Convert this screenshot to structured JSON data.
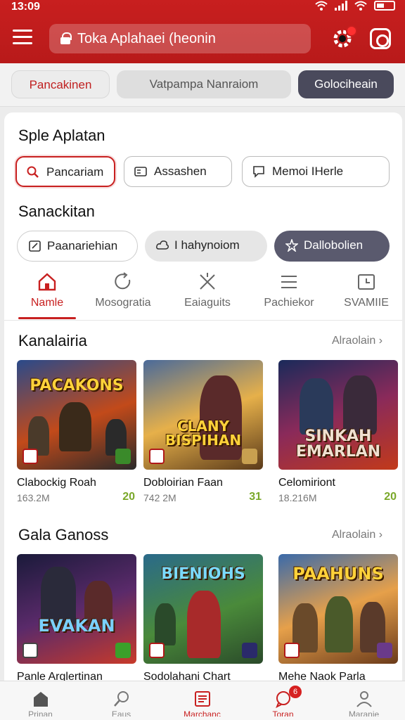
{
  "status_bar": {
    "time": "13:09"
  },
  "header": {
    "search_text": "Toka Aplahaei (heonin",
    "accent": "#c81f1f"
  },
  "top_tabs": [
    "Pancakinen",
    "Vatpampa Nanraiom",
    "Golociheain"
  ],
  "section1": {
    "title": "Sple Aplatan",
    "chips": [
      "Pancariam",
      "Assashen",
      "Memoi IHerle"
    ]
  },
  "section2": {
    "title": "Sanackitan",
    "chips": [
      "Paanariehian",
      "I hahynoiom",
      "Dallobolien"
    ]
  },
  "categories": [
    {
      "label": "Namle",
      "icon": "home-icon"
    },
    {
      "label": "Mosogratia",
      "icon": "refresh-icon"
    },
    {
      "label": "Eaiaguits",
      "icon": "cross-tools-icon"
    },
    {
      "label": "Pachiekor",
      "icon": "list-icon"
    },
    {
      "label": "SVAMIIE",
      "icon": "calendar-icon"
    }
  ],
  "rail1": {
    "title": "Kanalairia",
    "more": "Alraolain ›",
    "games": [
      {
        "thumb_title": "PACAKONS",
        "name": "Clabockig Roah",
        "size": "163.2M",
        "rating": "20"
      },
      {
        "thumb_title": "CLANY BISPIHAN",
        "name": "Dobloirian Faan",
        "size": "742 2M",
        "rating": "31"
      },
      {
        "thumb_title": "SINKAH EMARLAN",
        "name": "Celomiriont",
        "size": "18.216M",
        "rating": "20"
      }
    ]
  },
  "rail2": {
    "title": "Gala Ganoss",
    "more": "Alraolain ›",
    "games": [
      {
        "thumb_title": "EVAKAN",
        "name": "Panle Arglertinan"
      },
      {
        "thumb_title": "BIENIOHS",
        "name": "Sodolahani Chart"
      },
      {
        "thumb_title": "PAAHUNS",
        "name": "Mehe Naok Parla"
      }
    ]
  },
  "bottom_nav": [
    {
      "label": "Prinan",
      "icon": "home-icon"
    },
    {
      "label": "Eaus",
      "icon": "search-icon"
    },
    {
      "label": "Marchanc",
      "icon": "document-icon"
    },
    {
      "label": "Toran",
      "icon": "chat-icon",
      "badge": "6"
    },
    {
      "label": "Maranie",
      "icon": "profile-icon"
    }
  ]
}
